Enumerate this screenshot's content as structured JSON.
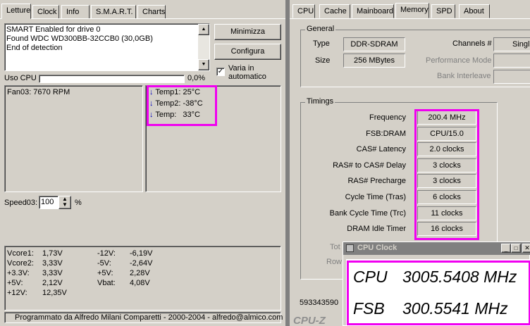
{
  "left": {
    "tabs": [
      "Letture",
      "Clock",
      "Info",
      "S.M.A.R.T.",
      "Charts"
    ],
    "log_lines": [
      "SMART Enabled for drive 0",
      "Found WDC WD300BB-32CCB0 (30,0GB)",
      "End of detection"
    ],
    "btn_minimizza": "Minimizza",
    "btn_configura": "Configura",
    "varia_label_1": "Varia in",
    "varia_label_2": "automatico",
    "cpu_usage_label": "Uso CPU",
    "cpu_usage_value": "0,0%",
    "cpu_usage_fraction": 0.0,
    "fan_text": "Fan03: 7670 RPM",
    "temps": [
      {
        "label": "Temp1:",
        "value": "25°C"
      },
      {
        "label": "Temp2:",
        "value": "-38°C"
      },
      {
        "label": "Temp:",
        "value": "33°C"
      }
    ],
    "speed_label": "Speed03:",
    "speed_value": "100",
    "speed_unit": "%",
    "voltages_left": [
      {
        "label": "Vcore1:",
        "value": "1,73V"
      },
      {
        "label": "Vcore2:",
        "value": "3,33V"
      },
      {
        "label": "+3.3V:",
        "value": "3,33V"
      },
      {
        "label": "+5V:",
        "value": "2,12V"
      },
      {
        "label": "+12V:",
        "value": "12,35V"
      }
    ],
    "voltages_right": [
      {
        "label": "-12V:",
        "value": "-6,19V"
      },
      {
        "label": "-5V:",
        "value": "-2,64V"
      },
      {
        "label": "+5V:",
        "value": "2,28V"
      },
      {
        "label": "Vbat:",
        "value": "4,08V"
      }
    ],
    "footer": "Programmato da Alfredo Milani Comparetti - 2000-2004 - alfredo@almico.com"
  },
  "right": {
    "tabs": [
      "CPU",
      "Cache",
      "Mainboard",
      "Memory",
      "SPD",
      "About"
    ],
    "active_tab": "Memory",
    "general_title": "General",
    "type_label": "Type",
    "type_value": "DDR-SDRAM",
    "size_label": "Size",
    "size_value": "256 MBytes",
    "channels_label": "Channels #",
    "channels_value": "Singl",
    "perf_mode_label": "Performance Mode",
    "bank_interleave_label": "Bank Interleave",
    "timings_title": "Timings",
    "timings": [
      {
        "label": "Frequency",
        "value": "200.4 MHz"
      },
      {
        "label": "FSB:DRAM",
        "value": "CPU/15.0"
      },
      {
        "label": "CAS# Latency",
        "value": "2.0 clocks"
      },
      {
        "label": "RAS# to CAS# Delay",
        "value": "3 clocks"
      },
      {
        "label": "RAS# Precharge",
        "value": "3 clocks"
      },
      {
        "label": "Cycle Time (Tras)",
        "value": "6 clocks"
      },
      {
        "label": "Bank Cycle Time (Trc)",
        "value": "11 clocks"
      },
      {
        "label": "DRAM Idle Timer",
        "value": "16 clocks"
      }
    ],
    "partial_label_1": "Tot",
    "partial_label_2": "Row",
    "bottom_number": "593343590",
    "brand": "CPU-Z"
  },
  "cpu_clock": {
    "title": "CPU Clock",
    "cpu_label": "CPU",
    "cpu_value": "3005.5408 MHz",
    "fsb_label": "FSB",
    "fsb_value": "300.5541 MHz"
  },
  "colors": {
    "highlight": "#f000f0",
    "titlebar": "#808080"
  }
}
